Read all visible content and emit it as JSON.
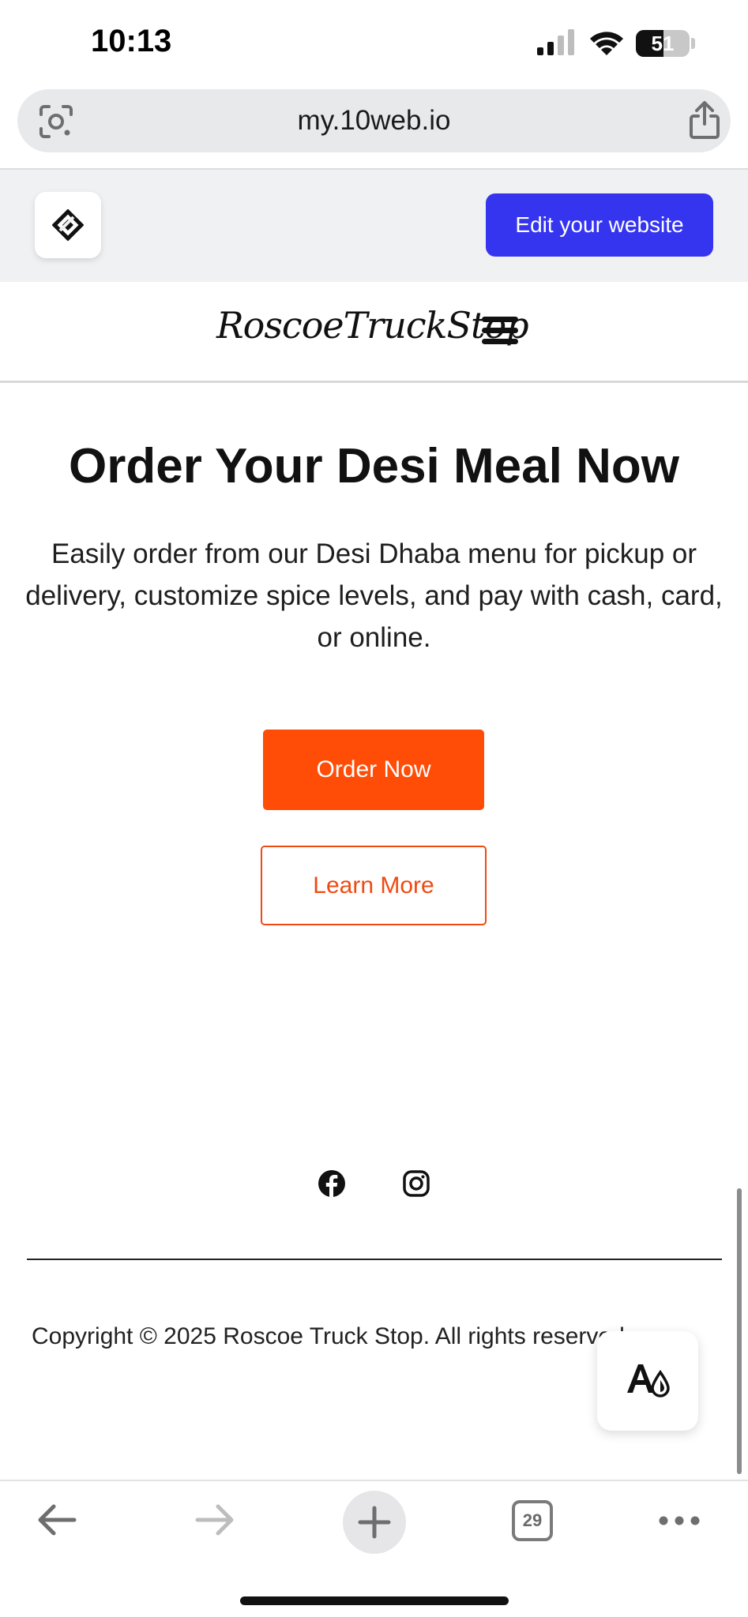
{
  "status_bar": {
    "time": "10:13",
    "battery_level": "51",
    "battery_fraction": 0.51
  },
  "browser": {
    "url": "my.10web.io",
    "tab_count": "29"
  },
  "toolbar": {
    "edit_label": "Edit your website",
    "accent_color": "#3535f0"
  },
  "site": {
    "logo_text": "RoscoeTruckStop"
  },
  "hero": {
    "title": "Order Your Desi Meal Now",
    "description": "Easily order from our Desi Dhaba menu for pickup or delivery, customize spice levels, and pay with cash, card, or online.",
    "primary_button": "Order Now",
    "secondary_button": "Learn More",
    "button_color": "#ff4d08"
  },
  "footer": {
    "social_icons": [
      "facebook-icon",
      "instagram-icon"
    ],
    "copyright": "Copyright © 2025 Roscoe Truck Stop. All rights reserved."
  },
  "icons": {
    "lens": "lens-icon",
    "share": "share-icon",
    "menu": "hamburger-menu-icon",
    "accessibility": "accessibility-icon",
    "back": "back-arrow-icon",
    "forward": "forward-arrow-icon",
    "new_tab": "plus-icon",
    "more": "more-icon"
  }
}
